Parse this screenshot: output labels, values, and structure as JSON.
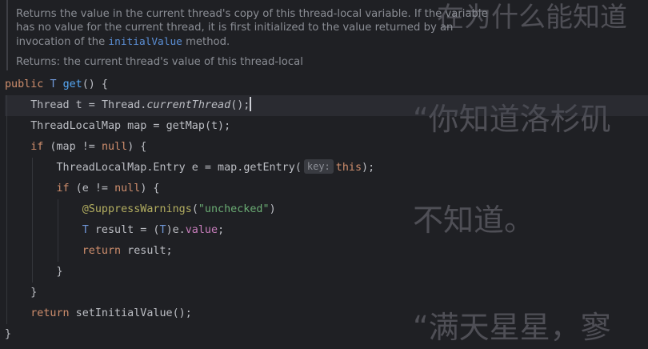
{
  "doc": {
    "text_before_link": "Returns the value in the current thread's copy of this thread-local variable. If the variable has no value for the current thread, it is first initialized to the value returned by an invocation of the ",
    "link": "initialValue",
    "text_after_link": " method.",
    "returns": "Returns: the current thread's value of this thread-local"
  },
  "background_text": {
    "line1": "在为什么能知道",
    "line2": "“你知道洛杉矶",
    "line3": "不知道。",
    "line4": "“满天星星，寥"
  },
  "code": {
    "l1_kw": "public",
    "l1_type": "T",
    "l1_fn": "get",
    "l1_rest": "() {",
    "l2_type": "Thread",
    "l2_var": " t = ",
    "l2_cls": "Thread.",
    "l2_fn": "currentThread",
    "l2_rest": "();",
    "l3_type": "ThreadLocalMap",
    "l3_var": " map = ",
    "l3_fn": "getMap",
    "l3_rest": "(t);",
    "l4_kw": "if",
    "l4_a": " (map != ",
    "l4_null": "null",
    "l4_b": ") {",
    "l5_type": "ThreadLocalMap.Entry",
    "l5_var": " e = map.",
    "l5_fn": "getEntry",
    "l5_open": "(",
    "l5_hint": "key:",
    "l5_this": "this",
    "l5_close": ");",
    "l6_kw": "if",
    "l6_a": " (e != ",
    "l6_null": "null",
    "l6_b": ") {",
    "l7_ann": "@SuppressWarnings",
    "l7_open": "(",
    "l7_str": "\"unchecked\"",
    "l7_close": ")",
    "l8_type": "T",
    "l8_a": " result = (",
    "l8_cast": "T",
    "l8_b": ")e.",
    "l8_field": "value",
    "l8_c": ";",
    "l9_kw": "return",
    "l9_rest": " result;",
    "l10": "}",
    "l11": "}",
    "l12_kw": "return",
    "l12_fn": " setInitialValue",
    "l12_rest": "();",
    "l13": "}"
  },
  "colors": {
    "background": "#1f2024",
    "keyword": "#cf8e6d",
    "string": "#6aab73",
    "annotation": "#b3ae60",
    "field": "#c77dbb",
    "generic": "#6f96d6"
  }
}
